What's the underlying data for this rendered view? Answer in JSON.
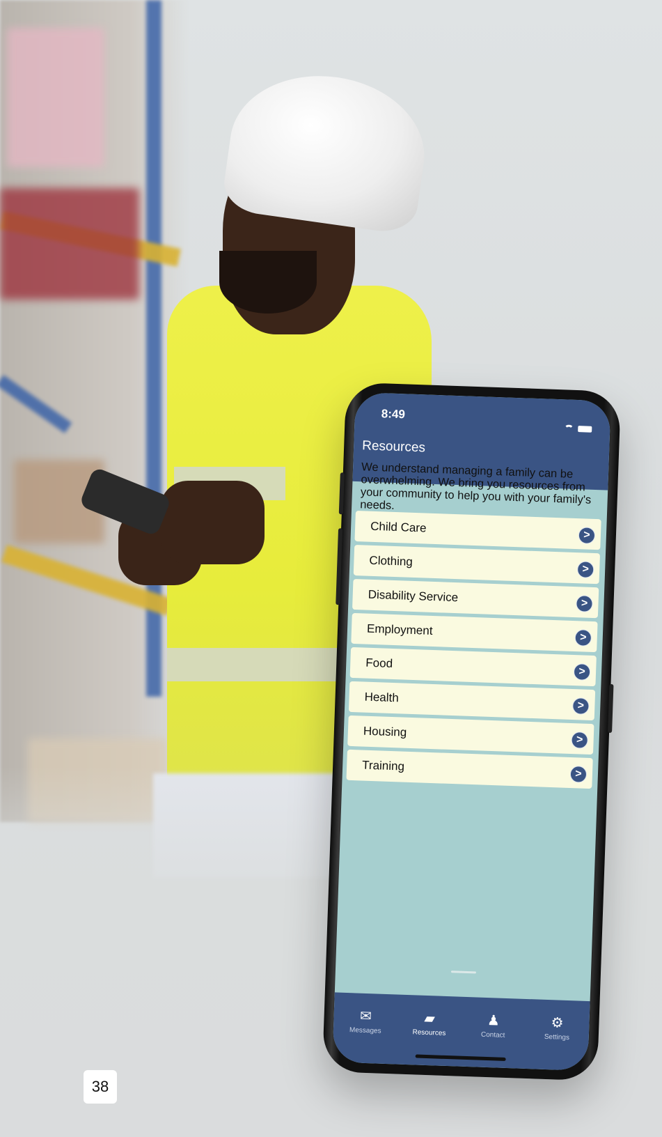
{
  "phone": {
    "status": {
      "time": "8:49"
    },
    "nav": {
      "title": "Resources"
    },
    "intro": "We understand managing a family can be overwhelming. We bring you resources from your community to help you with your family's needs.",
    "categories": [
      {
        "label": "Child Care"
      },
      {
        "label": "Clothing"
      },
      {
        "label": "Disability Service"
      },
      {
        "label": "Employment"
      },
      {
        "label": "Food"
      },
      {
        "label": "Health"
      },
      {
        "label": "Housing"
      },
      {
        "label": "Training"
      }
    ],
    "tabs": [
      {
        "label": "Messages",
        "icon": "envelope-icon",
        "glyph": "✉",
        "active": false
      },
      {
        "label": "Resources",
        "icon": "folder-icon",
        "glyph": "▰",
        "active": true
      },
      {
        "label": "Contact",
        "icon": "person-icon",
        "glyph": "♟",
        "active": false
      },
      {
        "label": "Settings",
        "icon": "gear-icon",
        "glyph": "⚙",
        "active": false
      }
    ],
    "colors": {
      "header": "#3a5484",
      "screen_bg": "#a6cfcf",
      "row_bg": "#fafae0"
    }
  },
  "page": {
    "number": "38"
  }
}
